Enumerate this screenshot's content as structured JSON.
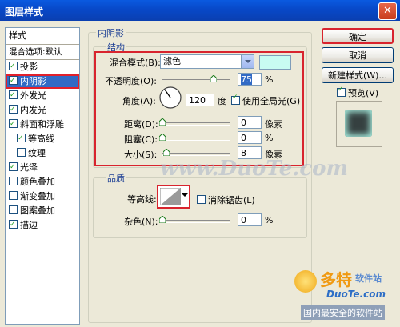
{
  "window": {
    "title": "图层样式"
  },
  "sidebar": {
    "header": "样式",
    "blend_default": "混合选项:默认",
    "items": [
      {
        "label": "投影",
        "checked": true,
        "sub": false,
        "selected": false
      },
      {
        "label": "内阴影",
        "checked": true,
        "sub": false,
        "selected": true
      },
      {
        "label": "外发光",
        "checked": true,
        "sub": false,
        "selected": false
      },
      {
        "label": "内发光",
        "checked": true,
        "sub": false,
        "selected": false
      },
      {
        "label": "斜面和浮雕",
        "checked": true,
        "sub": false,
        "selected": false
      },
      {
        "label": "等高线",
        "checked": true,
        "sub": true,
        "selected": false
      },
      {
        "label": "纹理",
        "checked": false,
        "sub": true,
        "selected": false
      },
      {
        "label": "光泽",
        "checked": true,
        "sub": false,
        "selected": false
      },
      {
        "label": "颜色叠加",
        "checked": false,
        "sub": false,
        "selected": false
      },
      {
        "label": "渐变叠加",
        "checked": false,
        "sub": false,
        "selected": false
      },
      {
        "label": "图案叠加",
        "checked": false,
        "sub": false,
        "selected": false
      },
      {
        "label": "描边",
        "checked": true,
        "sub": false,
        "selected": false
      }
    ]
  },
  "panel": {
    "title": "内阴影",
    "structure": {
      "title": "结构",
      "blend_mode_label": "混合模式(B):",
      "blend_mode_value": "滤色",
      "blend_color": "#c8fbf2",
      "opacity_label": "不透明度(O):",
      "opacity_value": "75",
      "opacity_fraction": 0.75,
      "pct": "%",
      "angle_label": "角度(A):",
      "angle_value": "120",
      "angle_unit": "度",
      "global_light_label": "使用全局光(G)",
      "global_light_checked": true,
      "distance_label": "距离(D):",
      "distance_value": "0",
      "px_unit": "像素",
      "choke_label": "阻塞(C):",
      "choke_value": "0",
      "size_label": "大小(S):",
      "size_value": "8"
    },
    "quality": {
      "title": "品质",
      "contour_label": "等高线:",
      "antialias_label": "消除锯齿(L)",
      "antialias_checked": false,
      "noise_label": "杂色(N):",
      "noise_value": "0"
    }
  },
  "buttons": {
    "ok": "确定",
    "cancel": "取消",
    "new_style": "新建样式(W)...",
    "preview": "预览(V)",
    "preview_checked": true
  },
  "watermarks": {
    "center": "www.DuoTe.com",
    "logo_main": "多特",
    "logo_sub": "软件站",
    "logo_url": "DuoTe.com",
    "logo_tag": "国内最安全的软件站"
  },
  "colors": {
    "accent_red": "#d8242e",
    "selection_blue": "#316ac5",
    "title_blue": "#0848c8"
  }
}
